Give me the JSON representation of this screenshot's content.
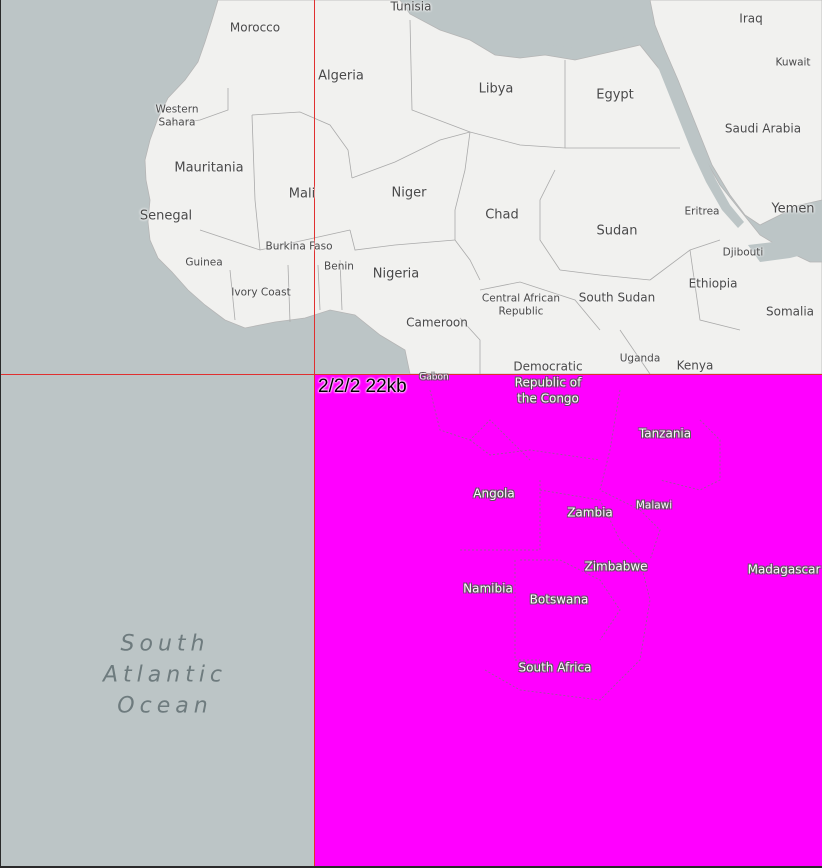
{
  "map": {
    "tile_info": "2/2/2 22kb",
    "colors": {
      "ocean": "#bcc5c6",
      "land": "#f1f1ef",
      "border": "#a8a8a8",
      "missing_tile": "#ff00ff",
      "tile_grid": "#e03030"
    },
    "countries": {
      "tunisia": "Tunisia",
      "iraq": "Iraq",
      "morocco": "Morocco",
      "algeria": "Algeria",
      "libya": "Libya",
      "egypt": "Egypt",
      "kuwait": "Kuwait",
      "western_sahara_line1": "Western",
      "western_sahara_line2": "Sahara",
      "saudi_arabia": "Saudi Arabia",
      "mauritania": "Mauritania",
      "mali": "Mali",
      "niger": "Niger",
      "chad": "Chad",
      "sudan": "Sudan",
      "eritrea": "Eritrea",
      "yemen": "Yemen",
      "senegal": "Senegal",
      "burkina_faso": "Burkina Faso",
      "djibouti": "Djibouti",
      "guinea": "Guinea",
      "benin": "Benin",
      "nigeria": "Nigeria",
      "ethiopia": "Ethiopia",
      "ivory_coast": "Ivory Coast",
      "car_line1": "Central African",
      "car_line2": "Republic",
      "south_sudan": "South Sudan",
      "somalia": "Somalia",
      "cameroon": "Cameroon",
      "uganda": "Uganda",
      "democratic": "Democratic",
      "kenya": "Kenya",
      "gabon": "Gabon",
      "roc_line1": "Republic of",
      "roc_line2": "the Congo",
      "tanzania": "Tanzania",
      "angola": "Angola",
      "malawi": "Malawi",
      "zambia": "Zambia",
      "zimbabwe": "Zimbabwe",
      "madagascar": "Madagascar",
      "namibia": "Namibia",
      "botswana": "Botswana",
      "south_africa": "South Africa"
    },
    "oceans": {
      "south_atlantic_line1": "South",
      "south_atlantic_line2": "Atlantic",
      "south_atlantic_line3": "Ocean"
    }
  }
}
